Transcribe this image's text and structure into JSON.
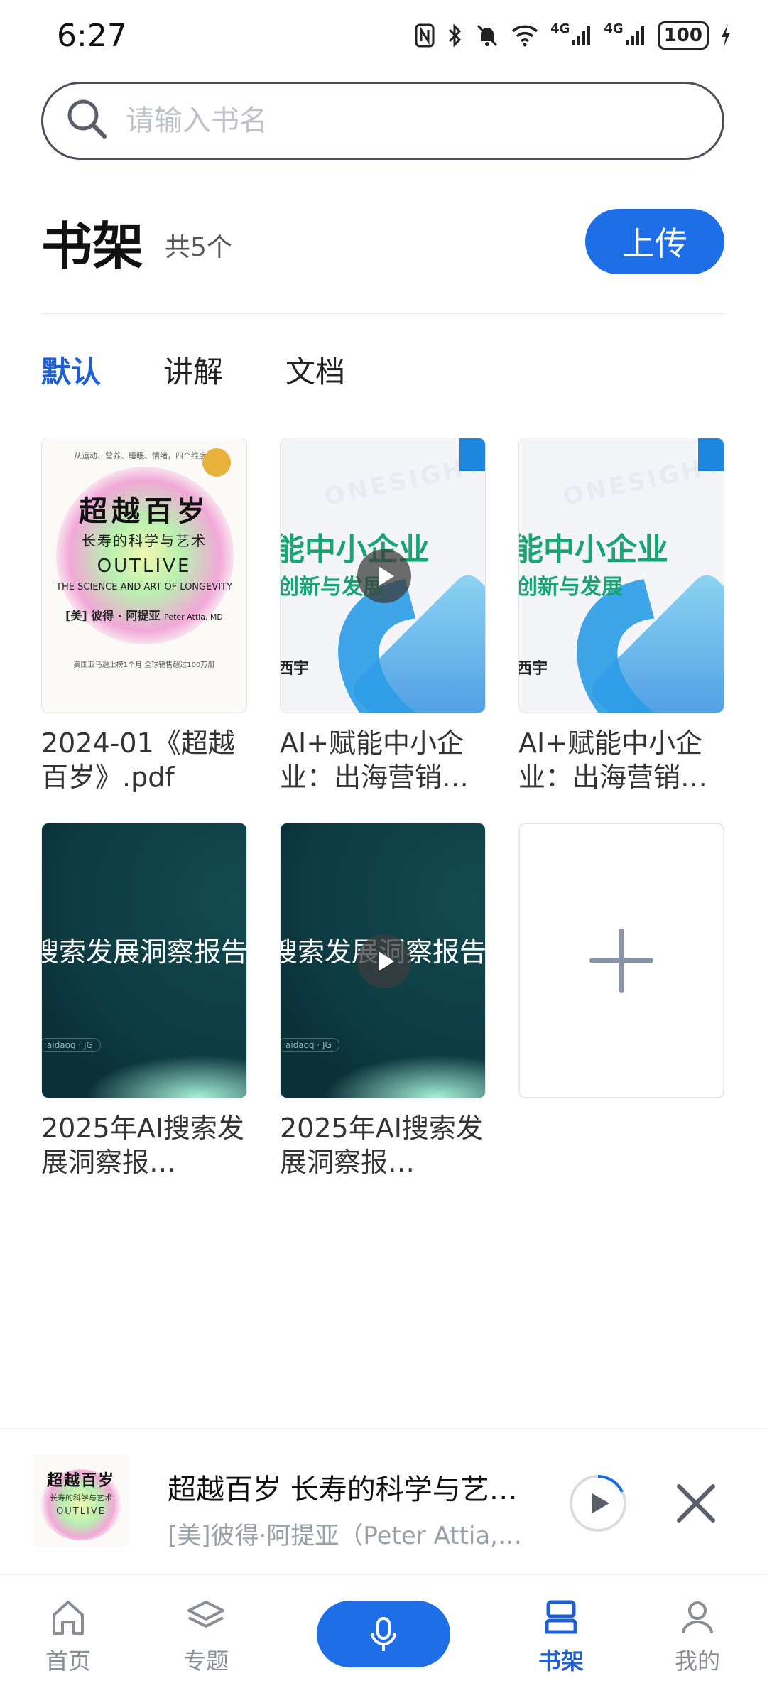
{
  "status_bar": {
    "time": "6:27",
    "network1": "4G",
    "network2": "4G",
    "battery": "100"
  },
  "search": {
    "placeholder": "请输入书名"
  },
  "header": {
    "title": "书架",
    "count": "共5个",
    "upload_label": "上传"
  },
  "tabs": [
    {
      "label": "默认",
      "active": true
    },
    {
      "label": "讲解",
      "active": false
    },
    {
      "label": "文档",
      "active": false
    }
  ],
  "books": [
    {
      "title": "2024-01《超越百岁》.pdf",
      "type": "book",
      "cover": {
        "top_line": "从运动、营养、睡眠、情绪，四个维度…",
        "title_zh": "超越百岁",
        "subtitle_zh": "长寿的科学与艺术",
        "title_en": "OUTLIVE",
        "subtitle_en": "THE SCIENCE AND ART OF LONGEVITY",
        "author": "[美] 彼得 · 阿提亚",
        "author_en": "Peter Attia, MD",
        "bottom": "美国亚马逊上榜1个月   全球销售超过100万册"
      }
    },
    {
      "title": "AI+赋能中小企业：出海营销…",
      "type": "slide",
      "has_play": true,
      "cover": {
        "watermark": "ONESIGHT",
        "line1": "能中小企业",
        "line2": "创新与发展",
        "foot": "西宇"
      }
    },
    {
      "title": "AI+赋能中小企业：出海营销…",
      "type": "slide",
      "has_play": false,
      "cover": {
        "watermark": "ONESIGHT",
        "line1": "能中小企业",
        "line2": "创新与发展",
        "foot": "西宇"
      }
    },
    {
      "title": "2025年AI搜索发展洞察报…",
      "type": "dark",
      "has_play": false,
      "cover": {
        "title": "搜索发展洞察报告",
        "tag": "aidaoq · JG"
      }
    },
    {
      "title": "2025年AI搜索发展洞察报…",
      "type": "dark",
      "has_play": true,
      "cover": {
        "title": "搜索发展洞察报告",
        "tag": "aidaoq · JG"
      }
    }
  ],
  "player": {
    "cover_title": "超越百岁",
    "cover_sub": "长寿的科学与艺术",
    "cover_en": "OUTLIVE",
    "title": "超越百岁 长寿的科学与艺…",
    "author": "[美]彼得·阿提亚（Peter Attia,…"
  },
  "nav": [
    {
      "label": "首页",
      "icon": "home-icon",
      "active": false
    },
    {
      "label": "专题",
      "icon": "layers-icon",
      "active": false
    },
    {
      "label": "",
      "icon": "microphone-icon",
      "active": false
    },
    {
      "label": "书架",
      "icon": "bookshelf-icon",
      "active": true
    },
    {
      "label": "我的",
      "icon": "profile-icon",
      "active": false
    }
  ],
  "colors": {
    "accent": "#1e6ee8",
    "active_tab": "#1e5fd1",
    "inactive_nav": "#888d96"
  }
}
